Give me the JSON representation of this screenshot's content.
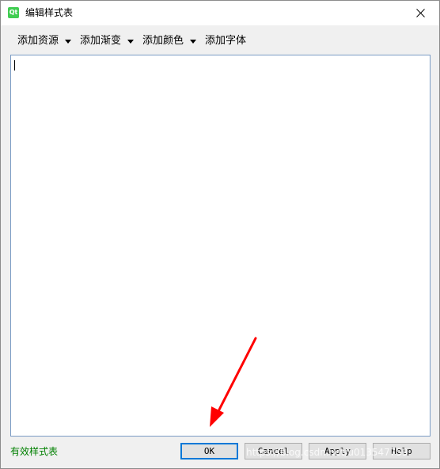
{
  "window": {
    "title": "编辑样式表",
    "app_icon_text": "Qt"
  },
  "toolbar": {
    "items": [
      {
        "label": "添加资源",
        "has_dropdown": true
      },
      {
        "label": "添加渐变",
        "has_dropdown": true
      },
      {
        "label": "添加颜色",
        "has_dropdown": true
      },
      {
        "label": "添加字体",
        "has_dropdown": false
      }
    ]
  },
  "editor": {
    "value": ""
  },
  "footer": {
    "status": "有效样式表",
    "status_color": "#008000",
    "ok_label": "OK",
    "cancel_label": "Cancel",
    "apply_label": "Apply",
    "help_label": "Help",
    "watermark": "https://blog.csdn.net/u013547759"
  },
  "colors": {
    "annotation_arrow": "#ff0000",
    "editor_border": "#7a9bc4",
    "focus_blue": "#0078d7"
  }
}
